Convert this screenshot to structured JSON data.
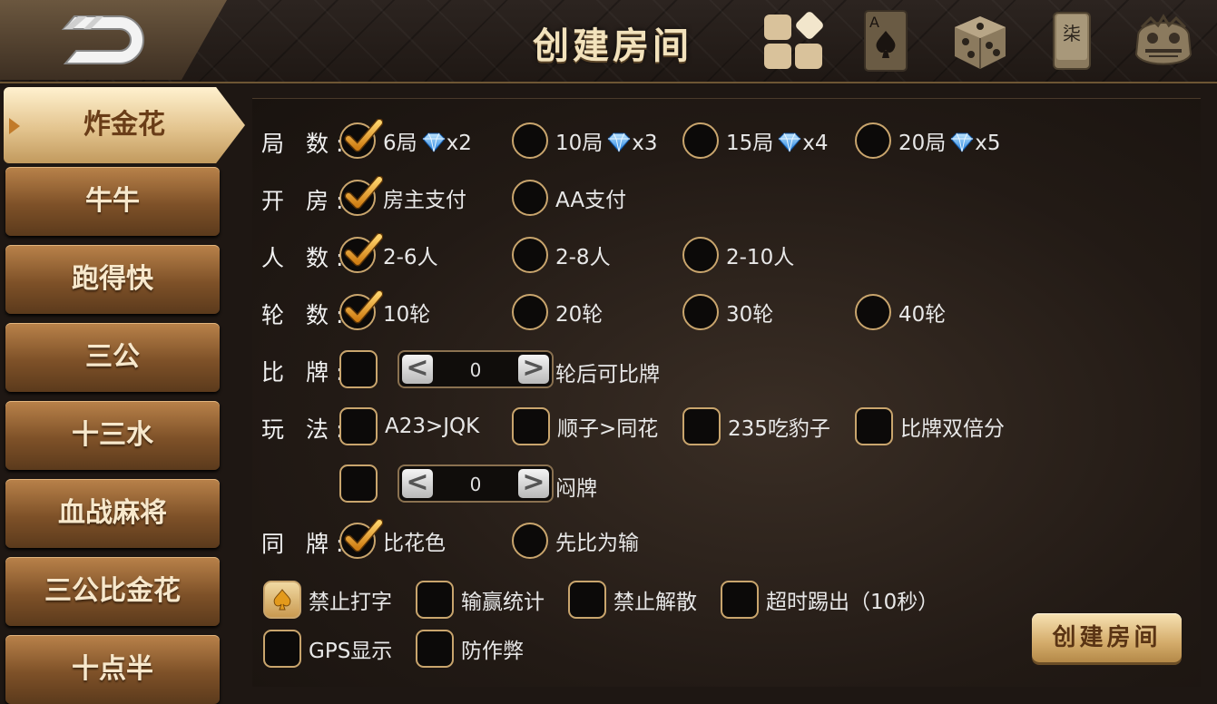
{
  "header": {
    "title": "创建房间",
    "icons": [
      "back-icon",
      "grid-icon",
      "ace-spade-card-icon",
      "dice-icon",
      "mahjong-tile-icon",
      "lion-dance-icon"
    ],
    "mahjong_tile_char": "柒",
    "card_letter": "A"
  },
  "sidebar": {
    "items": [
      {
        "label": "炸金花",
        "active": true
      },
      {
        "label": "牛牛",
        "active": false
      },
      {
        "label": "跑得快",
        "active": false
      },
      {
        "label": "三公",
        "active": false
      },
      {
        "label": "十三水",
        "active": false
      },
      {
        "label": "血战麻将",
        "active": false
      },
      {
        "label": "三公比金花",
        "active": false
      },
      {
        "label": "十点半",
        "active": false
      }
    ]
  },
  "rules": {
    "rounds": {
      "label": "局 数:",
      "options": [
        {
          "text": "6局",
          "cost": "x2",
          "checked": true
        },
        {
          "text": "10局",
          "cost": "x3",
          "checked": false
        },
        {
          "text": "15局",
          "cost": "x4",
          "checked": false
        },
        {
          "text": "20局",
          "cost": "x5",
          "checked": false
        }
      ]
    },
    "payment": {
      "label": "开 房:",
      "options": [
        {
          "text": "房主支付",
          "checked": true
        },
        {
          "text": "AA支付",
          "checked": false
        }
      ]
    },
    "players": {
      "label": "人 数:",
      "options": [
        {
          "text": "2-6人",
          "checked": true
        },
        {
          "text": "2-8人",
          "checked": false
        },
        {
          "text": "2-10人",
          "checked": false
        }
      ]
    },
    "turns": {
      "label": "轮 数:",
      "options": [
        {
          "text": "10轮",
          "checked": true
        },
        {
          "text": "20轮",
          "checked": false
        },
        {
          "text": "30轮",
          "checked": false
        },
        {
          "text": "40轮",
          "checked": false
        }
      ]
    },
    "compare": {
      "label": "比 牌:",
      "checked": false,
      "value": "0",
      "suffix": "轮后可比牌"
    },
    "play": {
      "label": "玩 法:",
      "options": [
        {
          "text": "A23>JQK",
          "checked": false
        },
        {
          "text": "顺子>同花",
          "checked": false
        },
        {
          "text": "235吃豹子",
          "checked": false
        },
        {
          "text": "比牌双倍分",
          "checked": false
        }
      ]
    },
    "blind": {
      "checked": false,
      "value": "0",
      "suffix": "闷牌"
    },
    "same": {
      "label": "同 牌:",
      "options": [
        {
          "text": "比花色",
          "checked": true
        },
        {
          "text": "先比为输",
          "checked": false
        }
      ]
    },
    "extras": [
      {
        "text": "禁止打字",
        "checked": true
      },
      {
        "text": "输赢统计",
        "checked": false
      },
      {
        "text": "禁止解散",
        "checked": false
      },
      {
        "text": "超时踢出（10秒）",
        "checked": false
      },
      {
        "text": "GPS显示",
        "checked": false
      },
      {
        "text": "防作弊",
        "checked": false
      }
    ]
  },
  "stepper": {
    "dec": "<",
    "inc": ">"
  },
  "create_button": "创建房间",
  "colors": {
    "accent": "#c9a56d",
    "check": "#e3a531",
    "diamond": "#39a8ff"
  }
}
